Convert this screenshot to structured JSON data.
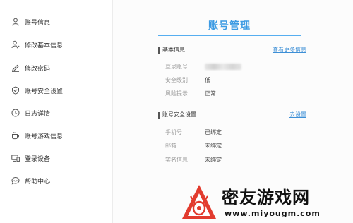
{
  "sidebar": {
    "items": [
      {
        "label": "账号信息",
        "icon": "user-icon"
      },
      {
        "label": "修改基本信息",
        "icon": "user-edit-icon"
      },
      {
        "label": "修改密码",
        "icon": "pencil-icon"
      },
      {
        "label": "账号安全设置",
        "icon": "shield-icon"
      },
      {
        "label": "日志详情",
        "icon": "clock-icon"
      },
      {
        "label": "账号游戏信息",
        "icon": "coffee-cup-icon"
      },
      {
        "label": "登录设备",
        "icon": "device-icon"
      },
      {
        "label": "帮助中心",
        "icon": "help-chat-icon"
      }
    ]
  },
  "main": {
    "title": "账号管理",
    "basic": {
      "title": "基本信息",
      "link": "查看更多信息",
      "rows": [
        {
          "label": "登录账号",
          "value": ""
        },
        {
          "label": "安全级别",
          "value": "低"
        },
        {
          "label": "风险提示",
          "value": "正常"
        }
      ]
    },
    "security": {
      "title": "账号安全设置",
      "link": "去设置",
      "rows": [
        {
          "label": "手机号",
          "value": "已绑定"
        },
        {
          "label": "邮箱",
          "value": "未绑定"
        },
        {
          "label": "实名信息",
          "value": "未绑定"
        }
      ]
    }
  },
  "watermark": {
    "name": "密友游戏网",
    "url": "www.miyougm.com"
  },
  "colors": {
    "accent": "#3d9be3",
    "link": "#3d8fd6",
    "watermark_red": "#e23b2e"
  }
}
